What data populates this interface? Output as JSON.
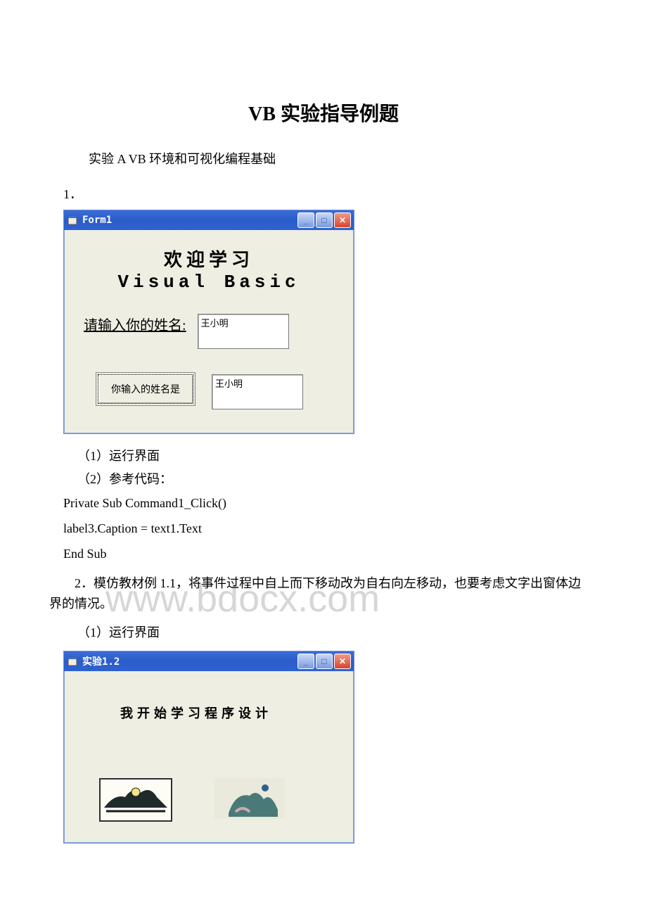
{
  "title": "VB 实验指导例题",
  "intro": "实验 A VB 环境和可视化编程基础",
  "section1_num": "1．",
  "form1": {
    "title": "Form1",
    "line1": "欢迎学习",
    "line2": "Visual Basic",
    "label_name": "请输入你的姓名:",
    "text_value": "王小明",
    "button_label": "你输入的姓名是",
    "output_value": "王小明"
  },
  "caption1": "（1）运行界面",
  "caption2": "（2）参考代码：",
  "code": {
    "line1": "Private Sub Command1_Click()",
    "line2": "label3.Caption = text1.Text",
    "line3": "End Sub"
  },
  "section2": "2．模仿教材例 1.1，将事件过程中自上而下移动改为自右向左移动，也要考虑文字出窗体边界的情况。",
  "caption3": "（1）运行界面",
  "form2": {
    "title": "实验1.2",
    "text": "我开始学习程序设计"
  },
  "watermark": "www.bdocx.com"
}
